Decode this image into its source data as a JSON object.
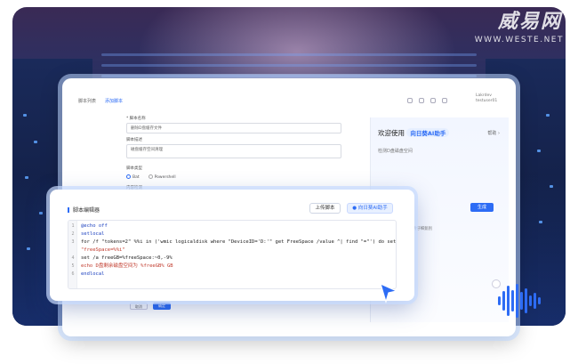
{
  "watermark": {
    "logo": "威易网",
    "url": "WWW.WESTE.NET"
  },
  "window": {
    "tabs": [
      {
        "label": "脚本列表"
      },
      {
        "label": "添加脚本",
        "active": true
      }
    ],
    "user": "Lakrdev testuser01"
  },
  "form": {
    "name_label": "* 脚本名称",
    "name_value": "删除D盘缓存文件",
    "desc_label": "脚本描述",
    "desc_value": "磁盘缓存空间清理",
    "type_label": "脚本类型",
    "type_options": [
      {
        "label": "Bat",
        "selected": true
      },
      {
        "label": "Powershell",
        "selected": false
      }
    ],
    "content_label": "内容检测",
    "cancel_label": "取消",
    "ok_label": "确定"
  },
  "ai_panel": {
    "title": "欢迎使用",
    "badge": "向日葵AI助手",
    "more": "帮助",
    "query": "检测D盘磁盘空间",
    "input_hint": "已输入字数: 18/100",
    "send_label": "生成",
    "footer": "由AI生成仅供参考, 请仔细甄别"
  },
  "editor": {
    "title": "脚本编辑器",
    "upload_label": "上传脚本",
    "ai_label": "向日葵AI助手",
    "lines": [
      {
        "num": "1",
        "text": "@echo off"
      },
      {
        "num": "2",
        "text": "setlocal"
      },
      {
        "num": "3",
        "text": "for /f \"tokens=2\" %%i in ('wmic logicaldisk where \"DeviceID='D:'\" get FreeSpace /value ^| find \"=\"') do set"
      },
      {
        "num": "",
        "text": "\"freeSpace=%%i\""
      },
      {
        "num": "4",
        "text": "set /a freeGB=%freeSpace:~0,-9%"
      },
      {
        "num": "5",
        "text": "echo D盘剩余磁盘空间为 %freeGB% GB"
      },
      {
        "num": "6",
        "text": "endlocal"
      }
    ]
  },
  "colors": {
    "accent": "#2d6cf5",
    "scene_top": "#3a2a55",
    "scene_bottom": "#142552"
  },
  "icons": {
    "cursor": "pointer-arrow-icon",
    "voice": "voice-wave-icon"
  }
}
